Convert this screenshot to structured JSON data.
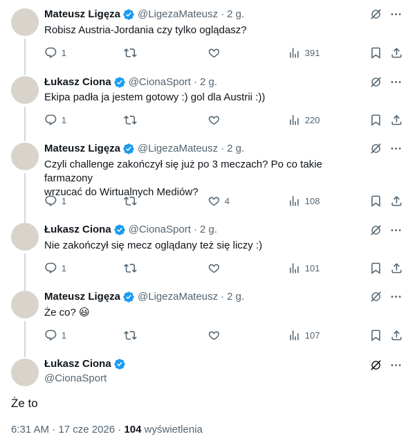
{
  "colors": {
    "verified": "#1d9bf0",
    "text": "#0f1419",
    "muted": "#536471",
    "line": "#cfd9de"
  },
  "icons": {
    "grok": "grok-slash-icon",
    "more": "more-dots-icon",
    "reply": "reply-icon",
    "repost": "repost-icon",
    "like": "heart-icon",
    "views": "views-bar-icon",
    "bookmark": "bookmark-icon",
    "share": "share-icon"
  },
  "replies": [
    {
      "name": "Mateusz Ligęza",
      "handle": "@LigezaMateusz",
      "dot": "·",
      "time": "2 g.",
      "lines": [
        "Robisz Austria-Jordania czy tylko oglądasz?"
      ],
      "reply_count": "1",
      "like_count": "",
      "views": "391"
    },
    {
      "name": "Łukasz Ciona",
      "handle": "@CionaSport",
      "dot": "·",
      "time": "2 g.",
      "lines": [
        "Ekipa padła ja jestem gotowy :) gol dla Austrii :))"
      ],
      "reply_count": "1",
      "like_count": "",
      "views": "220"
    },
    {
      "name": "Mateusz Ligęza",
      "handle": "@LigezaMateusz",
      "dot": "·",
      "time": "2 g.",
      "lines": [
        "Czyli challenge zakończył się już po 3 meczach? Po co takie farmazony",
        "wrzucać do Wirtualnych Mediów?"
      ],
      "reply_count": "1",
      "like_count": "4",
      "views": "108"
    },
    {
      "name": "Łukasz Ciona",
      "handle": "@CionaSport",
      "dot": "·",
      "time": "2 g.",
      "lines": [
        "Nie zakończył się mecz oglądany też się liczy :)"
      ],
      "reply_count": "1",
      "like_count": "",
      "views": "101"
    },
    {
      "name": "Mateusz Ligęza",
      "handle": "@LigezaMateusz",
      "dot": "·",
      "time": "2 g.",
      "lines": [
        "Że co? 😃"
      ],
      "reply_count": "1",
      "like_count": "",
      "views": "107"
    }
  ],
  "main": {
    "name": "Łukasz Ciona",
    "handle": "@CionaSport",
    "text": "Że to",
    "time": "6:31 AM",
    "sep1": "·",
    "date": "17 cze 2026",
    "sep2": "·",
    "views": "104",
    "views_label": "wyświetlenia"
  }
}
